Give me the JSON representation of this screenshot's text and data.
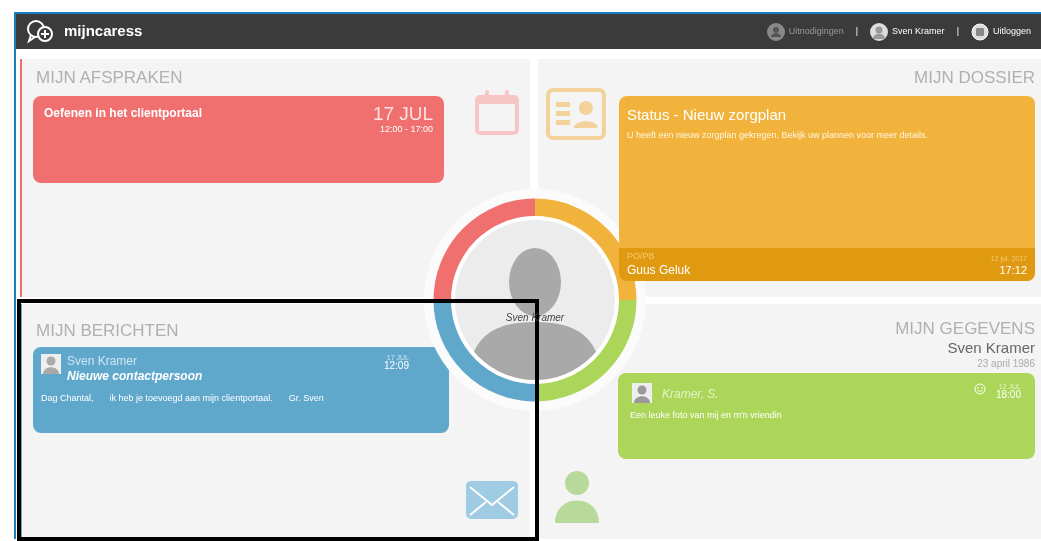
{
  "header": {
    "logo": "mijncaress",
    "separator": "|",
    "nav": [
      {
        "label": "Uitnodigingen",
        "kind": "invites",
        "disabled": true
      },
      {
        "label": "Sven Kramer",
        "kind": "user",
        "disabled": false
      },
      {
        "label": "Uitloggen",
        "kind": "logout",
        "disabled": false
      }
    ]
  },
  "appointments": {
    "title": "MIJN AFSPRAKEN",
    "items": [
      {
        "title": "Oefenen in het clientportaal",
        "date": "17 JUL",
        "time": "12:00 - 17:00"
      }
    ]
  },
  "dossier": {
    "title": "MIJN DOSSIER",
    "items": [
      {
        "title": "Status - Nieuw zorgplan",
        "text": "U heeft een nieuw zorgplan gekregen. Bekijk uw plannen voor meer details.",
        "role": "PO/PB",
        "author": "Guus Geluk",
        "date": "12 jul. 2017",
        "time": "17:12"
      }
    ]
  },
  "messages": {
    "title": "MIJN BERICHTEN",
    "items": [
      {
        "sender": "Sven Kramer",
        "subject": "Nieuwe contactpersoon",
        "body": [
          "Dag Chantal,",
          "ik heb je toevoegd aan mijn clientportaal.",
          "Gr. Sven"
        ],
        "date": "17 JUL",
        "time": "12:09"
      }
    ]
  },
  "details": {
    "title": "MIJN GEGEVENS",
    "name": "Sven Kramer",
    "birthdate": "23 april 1986",
    "items": [
      {
        "author": "Kramer, S.",
        "text": "Een leuke foto van mij en m'n vriendin",
        "date": "12 JUL",
        "time": "18:00"
      }
    ]
  },
  "profile": {
    "name": "Sven Kramer"
  }
}
